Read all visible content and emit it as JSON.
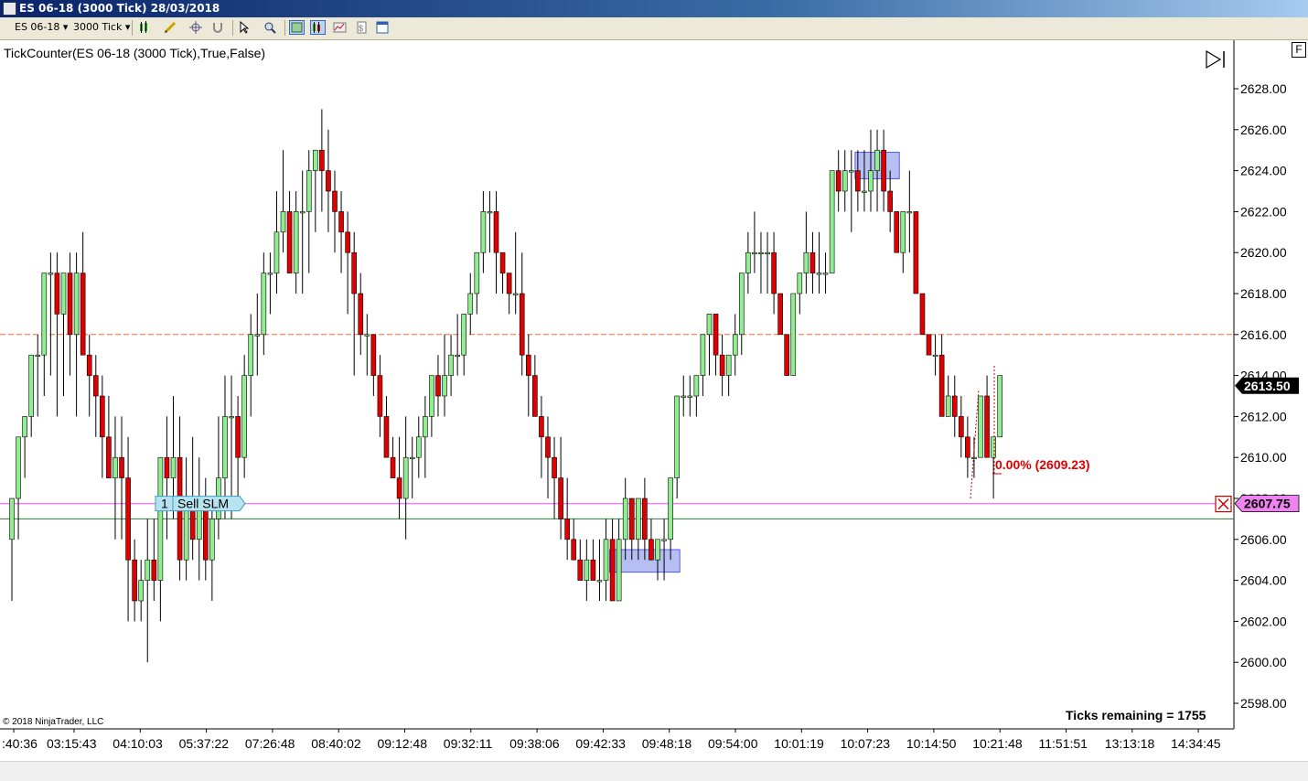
{
  "window": {
    "title": "ES 06-18 (3000 Tick)  28/03/2018"
  },
  "toolbar": {
    "instrument": "ES 06-18",
    "interval": "3000 Tick"
  },
  "indicator_label": "TickCounter(ES 06-18 (3000 Tick),True,False)",
  "ticks_remaining": "Ticks remaining = 1755",
  "copyright": "© 2018 NinjaTrader, LLC",
  "f_button": "F",
  "order": {
    "qty": "1",
    "label": "Sell SLM",
    "price_label": "2607.75",
    "price": 2607.75
  },
  "current_price": {
    "label": "2613.50",
    "value": 2613.5
  },
  "fib_label": "0.00% (2609.23)",
  "colors": {
    "up": "#90ee90",
    "down": "#e00000",
    "dashed_line": "#ff6633",
    "order_line": "#ee82ee",
    "zone": "#aab4f0"
  },
  "chart_data": {
    "type": "candlestick",
    "ylim": [
      2596.5,
      2630.2
    ],
    "y_ticks": [
      "2628.00",
      "2626.00",
      "2624.00",
      "2622.00",
      "2620.00",
      "2618.00",
      "2616.00",
      "2614.00",
      "2612.00",
      "2610.00",
      "2608.00",
      "2606.00",
      "2604.00",
      "2602.00",
      "2600.00",
      "2598.00"
    ],
    "x_ticks": [
      ":40:36",
      "03:15:43",
      "04:10:03",
      "05:37:22",
      "07:26:48",
      "08:40:02",
      "09:12:48",
      "09:32:11",
      "09:38:06",
      "09:42:33",
      "09:48:18",
      "09:54:00",
      "10:01:19",
      "10:07:23",
      "10:14:50",
      "10:21:48",
      "11:51:51",
      "13:13:18",
      "14:34:45"
    ],
    "horizontal_lines": [
      {
        "price": 2616.0,
        "style": "dashed",
        "color": "#ff6633"
      },
      {
        "price": 2607.75,
        "style": "solid",
        "color": "#ee82ee"
      },
      {
        "price": 2607.0,
        "style": "solid",
        "color": "#2e7d32"
      }
    ],
    "zones": [
      {
        "from_bar": 131,
        "to_bar": 137,
        "low": 2623.6,
        "high": 2624.9
      },
      {
        "from_bar": 93,
        "to_bar": 103,
        "low": 2604.4,
        "high": 2605.5
      }
    ],
    "ohlc": [
      [
        2606,
        2608,
        2603,
        2608
      ],
      [
        2608,
        2611,
        2606,
        2611
      ],
      [
        2611,
        2612,
        2609,
        2612
      ],
      [
        2612,
        2615,
        2611,
        2615
      ],
      [
        2615,
        2616,
        2612,
        2615
      ],
      [
        2615,
        2619,
        2613,
        2619
      ],
      [
        2619,
        2620,
        2614,
        2619
      ],
      [
        2619,
        2620,
        2612,
        2617
      ],
      [
        2617,
        2619,
        2613,
        2619
      ],
      [
        2619,
        2620,
        2614,
        2616
      ],
      [
        2616,
        2620,
        2612,
        2619
      ],
      [
        2619,
        2621,
        2615,
        2615
      ],
      [
        2615,
        2616,
        2612,
        2614
      ],
      [
        2614,
        2615,
        2611,
        2613
      ],
      [
        2613,
        2614,
        2609,
        2611
      ],
      [
        2611,
        2613,
        2609,
        2609
      ],
      [
        2609,
        2612,
        2606,
        2610
      ],
      [
        2610,
        2612,
        2606,
        2609
      ],
      [
        2609,
        2611,
        2602,
        2605
      ],
      [
        2605,
        2606,
        2602,
        2603
      ],
      [
        2603,
        2605,
        2602,
        2604
      ],
      [
        2604,
        2607,
        2600,
        2605
      ],
      [
        2605,
        2607,
        2603,
        2604
      ],
      [
        2604,
        2610,
        2602,
        2610
      ],
      [
        2610,
        2612,
        2606,
        2609
      ],
      [
        2609,
        2613,
        2607,
        2610
      ],
      [
        2610,
        2612,
        2604,
        2605
      ],
      [
        2605,
        2610,
        2604,
        2608
      ],
      [
        2608,
        2611,
        2605,
        2606
      ],
      [
        2606,
        2610,
        2604,
        2608
      ],
      [
        2608,
        2609,
        2604,
        2605
      ],
      [
        2605,
        2608,
        2603,
        2607
      ],
      [
        2607,
        2612,
        2606,
        2609
      ],
      [
        2609,
        2614,
        2607,
        2612
      ],
      [
        2612,
        2614,
        2607,
        2612
      ],
      [
        2612,
        2613,
        2608,
        2610
      ],
      [
        2610,
        2615,
        2609,
        2614
      ],
      [
        2614,
        2617,
        2612,
        2616
      ],
      [
        2616,
        2618,
        2614,
        2616
      ],
      [
        2616,
        2620,
        2615,
        2619
      ],
      [
        2619,
        2620,
        2617,
        2619
      ],
      [
        2619,
        2623,
        2618,
        2621
      ],
      [
        2621,
        2625,
        2620,
        2622
      ],
      [
        2622,
        2623,
        2619,
        2619
      ],
      [
        2619,
        2623,
        2618,
        2622
      ],
      [
        2622,
        2624,
        2618,
        2622
      ],
      [
        2622,
        2625,
        2619,
        2624
      ],
      [
        2624,
        2625,
        2621,
        2625
      ],
      [
        2625,
        2627,
        2622,
        2624
      ],
      [
        2624,
        2626,
        2621,
        2623
      ],
      [
        2623,
        2624,
        2620,
        2622
      ],
      [
        2622,
        2623,
        2619,
        2621
      ],
      [
        2621,
        2622,
        2617,
        2620
      ],
      [
        2620,
        2621,
        2614,
        2618
      ],
      [
        2618,
        2619,
        2615,
        2616
      ],
      [
        2616,
        2617,
        2614,
        2616
      ],
      [
        2616,
        2616,
        2613,
        2614
      ],
      [
        2614,
        2615,
        2611,
        2612
      ],
      [
        2612,
        2613,
        2610,
        2610
      ],
      [
        2610,
        2611,
        2609,
        2609
      ],
      [
        2609,
        2611,
        2607,
        2608
      ],
      [
        2608,
        2612,
        2606,
        2610
      ],
      [
        2610,
        2611,
        2608,
        2610
      ],
      [
        2610,
        2612,
        2609,
        2611
      ],
      [
        2611,
        2613,
        2609,
        2612
      ],
      [
        2612,
        2614,
        2611,
        2614
      ],
      [
        2614,
        2615,
        2612,
        2613
      ],
      [
        2613,
        2616,
        2612,
        2614
      ],
      [
        2614,
        2616,
        2613,
        2615
      ],
      [
        2615,
        2617,
        2614,
        2615
      ],
      [
        2615,
        2617,
        2614,
        2617
      ],
      [
        2617,
        2619,
        2616,
        2618
      ],
      [
        2618,
        2620,
        2617,
        2620
      ],
      [
        2620,
        2623,
        2619,
        2622
      ],
      [
        2622,
        2623,
        2620,
        2622
      ],
      [
        2622,
        2623,
        2618,
        2620
      ],
      [
        2620,
        2620,
        2618,
        2619
      ],
      [
        2619,
        2619,
        2617,
        2618
      ],
      [
        2618,
        2621,
        2617,
        2618
      ],
      [
        2618,
        2620,
        2614,
        2615
      ],
      [
        2615,
        2616,
        2612,
        2614
      ],
      [
        2614,
        2615,
        2612,
        2612
      ],
      [
        2612,
        2613,
        2609,
        2611
      ],
      [
        2611,
        2612,
        2608,
        2610
      ],
      [
        2610,
        2611,
        2607,
        2609
      ],
      [
        2609,
        2611,
        2606,
        2607
      ],
      [
        2607,
        2609,
        2605,
        2606
      ],
      [
        2606,
        2607,
        2605,
        2605
      ],
      [
        2605,
        2606,
        2604,
        2604
      ],
      [
        2604,
        2606,
        2603,
        2605
      ],
      [
        2605,
        2606,
        2604,
        2604
      ],
      [
        2604,
        2606,
        2603,
        2604
      ],
      [
        2604,
        2607,
        2603,
        2606
      ],
      [
        2606,
        2607,
        2603,
        2603
      ],
      [
        2603,
        2607,
        2603,
        2606
      ],
      [
        2606,
        2609,
        2605,
        2608
      ],
      [
        2608,
        2608,
        2605,
        2606
      ],
      [
        2606,
        2608,
        2605,
        2608
      ],
      [
        2608,
        2609,
        2605,
        2606
      ],
      [
        2606,
        2607,
        2605,
        2605
      ],
      [
        2605,
        2606,
        2604,
        2606
      ],
      [
        2606,
        2607,
        2604,
        2606
      ],
      [
        2606,
        2609,
        2605,
        2609
      ],
      [
        2609,
        2613,
        2608,
        2613
      ],
      [
        2613,
        2614,
        2612,
        2613
      ],
      [
        2613,
        2614,
        2612,
        2613
      ],
      [
        2613,
        2614,
        2612,
        2614
      ],
      [
        2614,
        2616,
        2613,
        2616
      ],
      [
        2616,
        2617,
        2614,
        2617
      ],
      [
        2617,
        2617,
        2614,
        2615
      ],
      [
        2615,
        2616,
        2613,
        2614
      ],
      [
        2614,
        2615,
        2613,
        2615
      ],
      [
        2615,
        2617,
        2614,
        2616
      ],
      [
        2616,
        2619,
        2615,
        2619
      ],
      [
        2619,
        2621,
        2618,
        2620
      ],
      [
        2620,
        2622,
        2619,
        2620
      ],
      [
        2620,
        2621,
        2618,
        2620
      ],
      [
        2620,
        2621,
        2618,
        2620
      ],
      [
        2620,
        2621,
        2617,
        2618
      ],
      [
        2618,
        2618,
        2616,
        2616
      ],
      [
        2616,
        2616,
        2614,
        2614
      ],
      [
        2614,
        2618,
        2614,
        2618
      ],
      [
        2618,
        2619,
        2617,
        2619
      ],
      [
        2619,
        2622,
        2618,
        2620
      ],
      [
        2620,
        2621,
        2618,
        2619
      ],
      [
        2619,
        2621,
        2618,
        2619
      ],
      [
        2619,
        2620,
        2618,
        2619
      ],
      [
        2619,
        2624,
        2619,
        2624
      ],
      [
        2624,
        2625,
        2622,
        2623
      ],
      [
        2623,
        2625,
        2622,
        2624
      ],
      [
        2624,
        2625,
        2621,
        2624
      ],
      [
        2624,
        2625,
        2622,
        2623
      ],
      [
        2623,
        2625,
        2622,
        2623
      ],
      [
        2623,
        2626,
        2622,
        2624
      ],
      [
        2624,
        2626,
        2622,
        2625
      ],
      [
        2625,
        2626,
        2622,
        2623
      ],
      [
        2623,
        2624,
        2621,
        2622
      ],
      [
        2622,
        2622,
        2620,
        2620
      ],
      [
        2620,
        2622,
        2619,
        2622
      ],
      [
        2622,
        2624,
        2620,
        2622
      ],
      [
        2622,
        2622,
        2618,
        2618
      ],
      [
        2618,
        2618,
        2616,
        2616
      ],
      [
        2616,
        2616,
        2615,
        2615
      ],
      [
        2615,
        2616,
        2614,
        2615
      ],
      [
        2615,
        2616,
        2612,
        2612
      ],
      [
        2612,
        2614,
        2612,
        2613
      ],
      [
        2613,
        2614,
        2611,
        2612
      ],
      [
        2612,
        2613,
        2610,
        2611
      ],
      [
        2611,
        2612,
        2609,
        2610
      ],
      [
        2610,
        2611,
        2609,
        2610
      ],
      [
        2610,
        2613,
        2610,
        2613
      ],
      [
        2613,
        2614,
        2610,
        2610
      ],
      [
        2610,
        2611,
        2608,
        2611
      ],
      [
        2611,
        2614,
        2611,
        2614
      ]
    ]
  }
}
